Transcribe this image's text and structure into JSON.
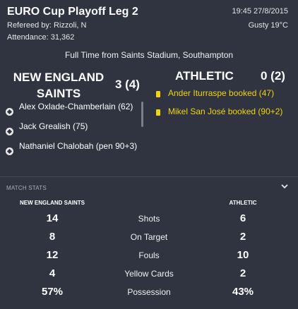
{
  "match": {
    "title": "EURO Cup Playoff Leg 2",
    "referee": "Refereed by: Rizzoli, N",
    "attendance": "Attendance: 31,362",
    "datetime": "19:45 27/8/2015",
    "weather": "Gusty 19°C",
    "full_time": "Full Time from Saints Stadium, Southampton"
  },
  "home": {
    "name": "NEW ENGLAND SAINTS",
    "score": "3 (4)",
    "events": [
      {
        "icon": "football-icon",
        "text": "Alex Oxlade-Chamberlain (62)"
      },
      {
        "icon": "football-icon",
        "text": "Jack Grealish (75)"
      },
      {
        "icon": "football-icon",
        "text": "Nathaniel Chalobah (pen 90+3)"
      }
    ]
  },
  "away": {
    "name": "ATHLETIC",
    "score": "0 (2)",
    "events": [
      {
        "icon": "yellow-card-icon",
        "text": "Ander Iturraspe booked (47)"
      },
      {
        "icon": "yellow-card-icon",
        "text": "Mikel San José booked (90+2)"
      }
    ]
  },
  "stats": {
    "section_label": "MATCH STATS",
    "home_header": "NEW ENGLAND SAINTS",
    "away_header": "ATHLETIC",
    "rows": [
      {
        "label": "Shots",
        "home": "14",
        "away": "6"
      },
      {
        "label": "On Target",
        "home": "8",
        "away": "2"
      },
      {
        "label": "Fouls",
        "home": "12",
        "away": "10"
      },
      {
        "label": "Yellow Cards",
        "home": "4",
        "away": "2"
      },
      {
        "label": "Possession",
        "home": "57%",
        "away": "43%"
      }
    ]
  },
  "colors": {
    "background": "#2f3440",
    "card_yellow": "#f2d40d"
  }
}
